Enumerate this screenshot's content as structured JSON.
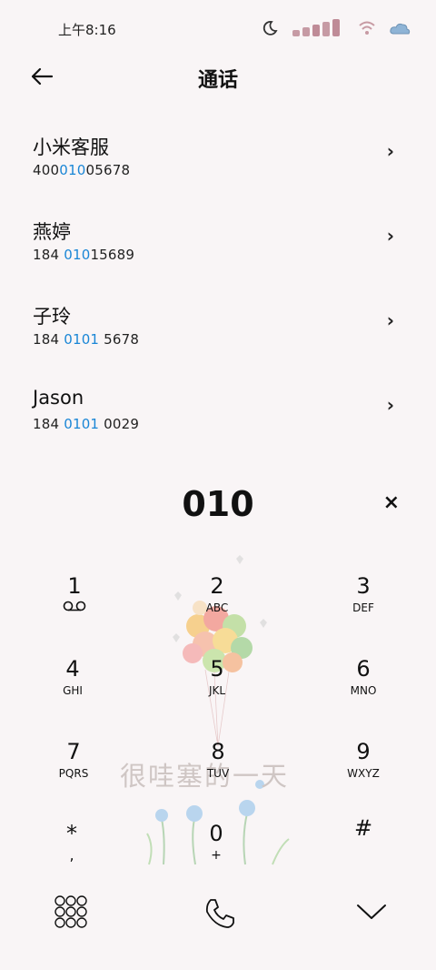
{
  "status_bar": {
    "time": "上午8:16"
  },
  "header": {
    "title": "通话"
  },
  "results": [
    {
      "name": "小米客服",
      "num_pre": "400",
      "num_hl": "010",
      "num_post": "05678"
    },
    {
      "name": "燕婷",
      "num_pre": "184 ",
      "num_hl": "010",
      "num_post": "15689"
    },
    {
      "name": "子玲",
      "num_pre": "184 ",
      "num_hl": "0101",
      "num_post": " 5678"
    },
    {
      "name": "Jason",
      "num_pre": "184 ",
      "num_hl": "0101",
      "num_post": " 0029"
    }
  ],
  "dialer": {
    "input": "010",
    "clear_glyph": "×"
  },
  "wallpaper": {
    "caption": "很哇塞的一天"
  },
  "keypad": {
    "keys": [
      {
        "digit": "1",
        "letters": ""
      },
      {
        "digit": "2",
        "letters": "ABC"
      },
      {
        "digit": "3",
        "letters": "DEF"
      },
      {
        "digit": "4",
        "letters": "GHI"
      },
      {
        "digit": "5",
        "letters": "JKL"
      },
      {
        "digit": "6",
        "letters": "MNO"
      },
      {
        "digit": "7",
        "letters": "PQRS"
      },
      {
        "digit": "8",
        "letters": "TUV"
      },
      {
        "digit": "9",
        "letters": "WXYZ"
      },
      {
        "digit": "*",
        "letters": ","
      },
      {
        "digit": "0",
        "letters": "+"
      },
      {
        "digit": "#",
        "letters": ""
      }
    ]
  },
  "colors": {
    "highlight": "#1a86d6",
    "background": "#f9f5f6"
  },
  "icons": {
    "back": "arrow-left-icon",
    "chevron": "chevron-right-icon",
    "voicemail": "voicemail-icon",
    "keypad_toggle": "keypad-grid-icon",
    "call": "phone-icon",
    "collapse": "chevron-down-icon"
  }
}
